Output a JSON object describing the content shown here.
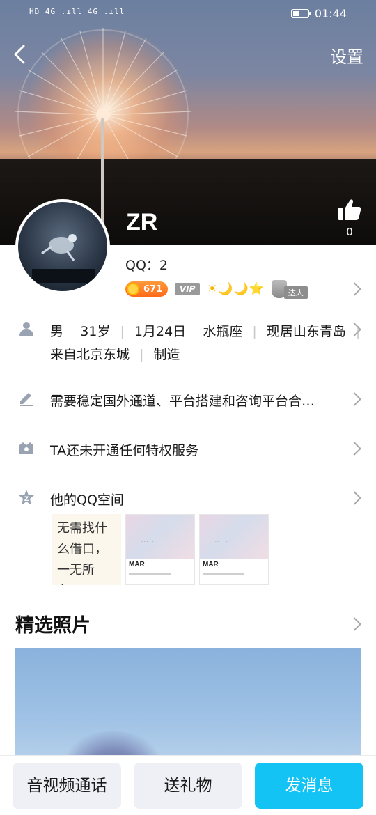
{
  "status_bar": {
    "left_indicators": "HD 4G .ıll 4G .ıll",
    "time": "01:44"
  },
  "nav": {
    "settings_label": "设置"
  },
  "profile": {
    "name": "ZR",
    "like_count": "0",
    "qq_label": "QQ：2",
    "coin_value": "671",
    "vip_label": "VIP",
    "level_icons": "☀🌙🌙⭐",
    "daren_label": "达人"
  },
  "details": {
    "gender": "男",
    "age": "31岁",
    "birthday": "1月24日",
    "zodiac": "水瓶座",
    "location": "现居山东青岛",
    "hometown": "来自北京东城",
    "job": "制造",
    "signature": "需要稳定国外通道、平台搭建和咨询平台合…",
    "privilege": "TA还未开通任何特权服务",
    "qzone": "他的QQ空间"
  },
  "qzone_thumbs": {
    "text_lines": [
      "无需找什",
      "么借口，",
      "一无所有…"
    ],
    "pic1_month": "MAR",
    "pic2_month": "MAR"
  },
  "featured": {
    "title": "精选照片"
  },
  "bottom_bar": {
    "call_label": "音视频通话",
    "gift_label": "送礼物",
    "message_label": "发消息"
  },
  "colors": {
    "primary": "#12c3f4",
    "coin": "#ff7a22",
    "gray_button": "#eef0f5"
  }
}
